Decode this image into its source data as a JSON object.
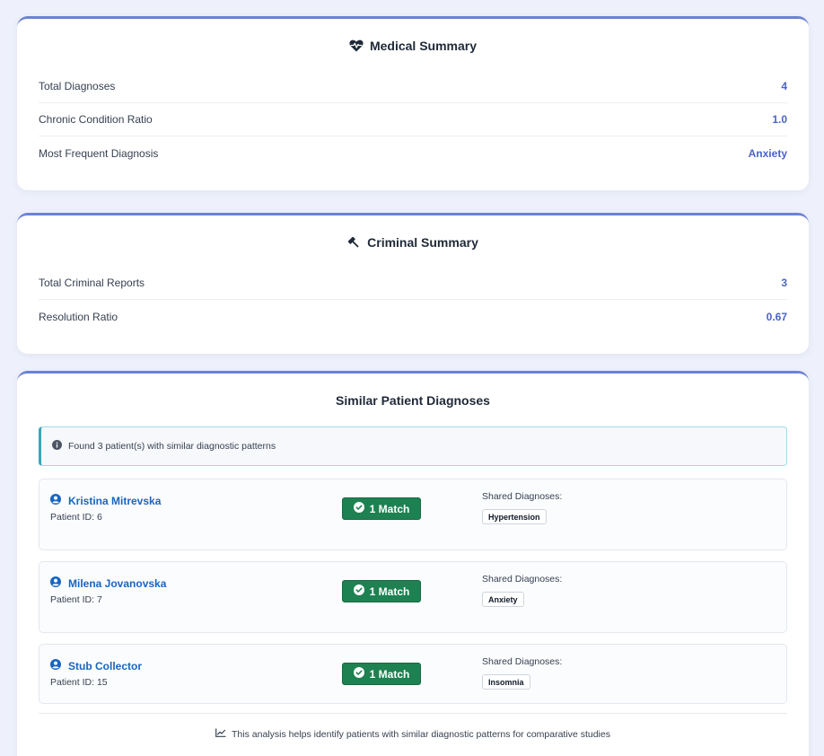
{
  "medical": {
    "title": "Medical Summary",
    "icon": "heartbeat-icon",
    "rows": [
      {
        "label": "Total Diagnoses",
        "value": "4"
      },
      {
        "label": "Chronic Condition Ratio",
        "value": "1.0"
      },
      {
        "label": "Most Frequent Diagnosis",
        "value": "Anxiety"
      }
    ]
  },
  "criminal": {
    "title": "Criminal Summary",
    "icon": "gavel-icon",
    "rows": [
      {
        "label": "Total Criminal Reports",
        "value": "3"
      },
      {
        "label": "Resolution Ratio",
        "value": "0.67"
      }
    ]
  },
  "similar": {
    "title": "Similar Patient Diagnoses",
    "info": "Found 3 patient(s) with similar diagnostic patterns",
    "shared_label": "Shared Diagnoses:",
    "patients": [
      {
        "name": "Kristina Mitrevska",
        "id": "Patient ID: 6",
        "match": "1 Match",
        "diagnosis": "Hypertension"
      },
      {
        "name": "Milena Jovanovska",
        "id": "Patient ID: 7",
        "match": "1 Match",
        "diagnosis": "Anxiety"
      },
      {
        "name": "Stub Collector",
        "id": "Patient ID: 15",
        "match": "1 Match",
        "diagnosis": "Insomnia"
      }
    ],
    "footer": "This analysis helps identify patients with similar diagnostic patterns for comparative studies"
  },
  "colors": {
    "accent": "#6b82d6",
    "value": "#4a63c9",
    "link": "#1766c2",
    "match_green": "#1e8151",
    "page_bg": "#eef1fb"
  }
}
